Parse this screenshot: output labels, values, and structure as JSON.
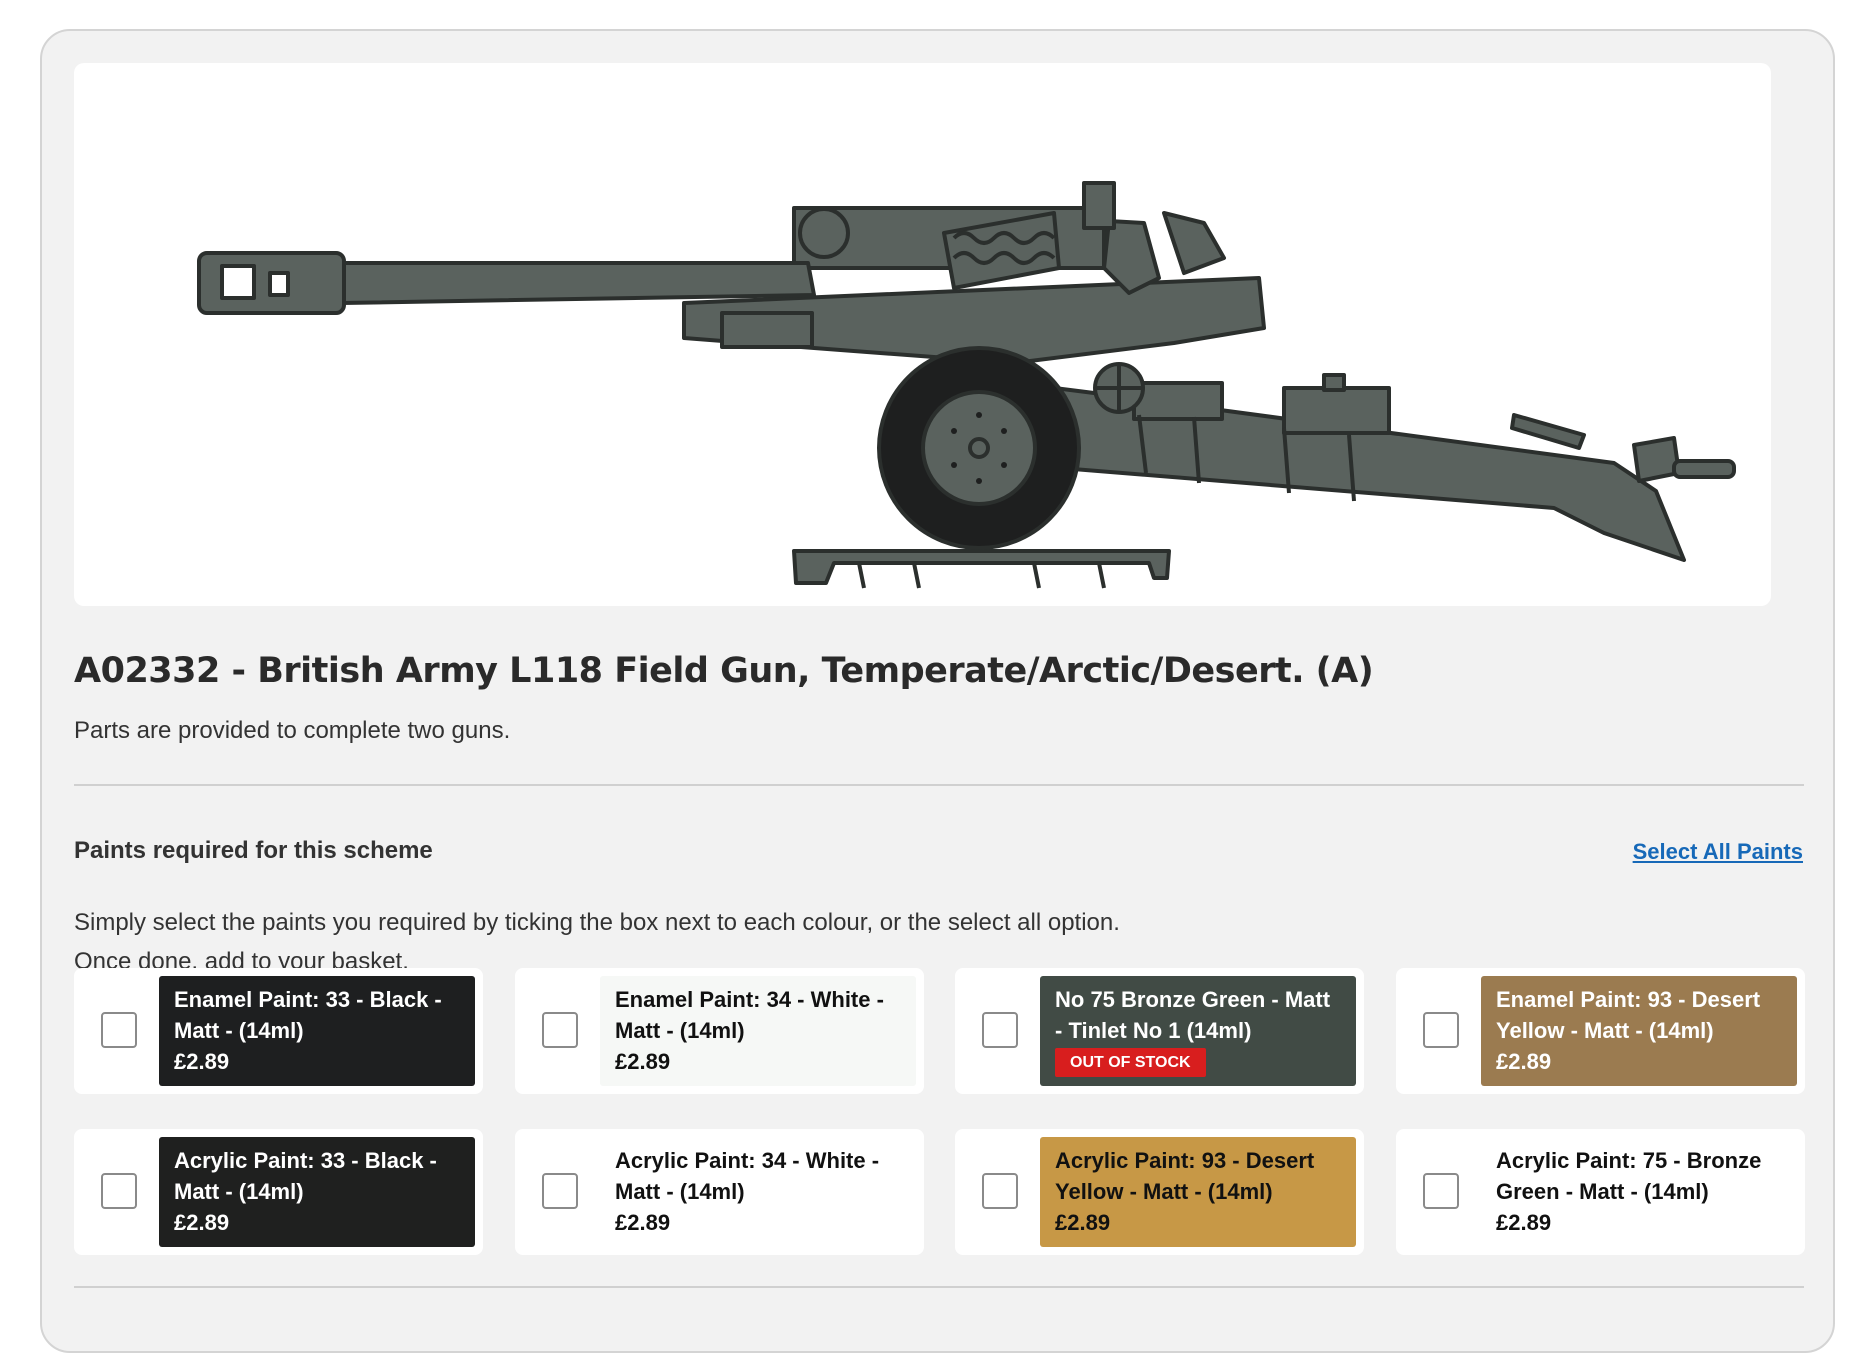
{
  "product": {
    "image_alt": "British Army L118 field gun side profile illustration",
    "title": "A02332 - British Army L118 Field Gun, Temperate/Arctic/Desert. (A)",
    "subtitle": "Parts are provided to complete two guns."
  },
  "paints_section": {
    "heading": "Paints required for this scheme",
    "select_all_label": "Select All Paints",
    "instructions_line1": "Simply select the paints you required by ticking the box next to each colour, or the select all option.",
    "instructions_line2": "Once done, add to your basket.",
    "paints": [
      {
        "name": "Enamel Paint: 33 - Black - Matt - (14ml)",
        "price": "£2.89",
        "swatch_color": "#1e1f20",
        "text_color": "light",
        "checked": false
      },
      {
        "name": "Enamel Paint: 34 - White - Matt - (14ml)",
        "price": "£2.89",
        "swatch_color": "#f6f8f6",
        "text_color": "dark",
        "checked": false
      },
      {
        "name": "No 75 Bronze Green - Matt - Tinlet No 1 (14ml)",
        "badge": "OUT OF STOCK",
        "swatch_color": "#414b45",
        "badge_color": "#d81e1e",
        "text_color": "light",
        "checked": false
      },
      {
        "name": "Enamel Paint: 93 - Desert Yellow - Matt - (14ml)",
        "price": "£2.89",
        "swatch_color": "#9b7b50",
        "text_color": "light",
        "checked": false
      },
      {
        "name": "Acrylic Paint: 33 - Black - Matt - (14ml)",
        "price": "£2.89",
        "swatch_color": "#1f201f",
        "text_color": "light",
        "checked": false
      },
      {
        "name": "Acrylic Paint: 34 - White - Matt - (14ml)",
        "price": "£2.89",
        "swatch_color": "#ffffff",
        "text_color": "dark",
        "checked": false
      },
      {
        "name": "Acrylic Paint: 93 - Desert Yellow - Matt - (14ml)",
        "price": "£2.89",
        "swatch_color": "#c79846",
        "text_color": "dark",
        "checked": false
      },
      {
        "name": "Acrylic Paint: 75 - Bronze Green - Matt - (14ml)",
        "price": "£2.89",
        "swatch_color": "#ffffff",
        "text_color": "dark",
        "checked": false
      }
    ]
  },
  "colors": {
    "gun_body": "#5a625e",
    "gun_outline": "#2b2f2d",
    "wheel": "#1e1f1f",
    "link": "#1769b8"
  }
}
